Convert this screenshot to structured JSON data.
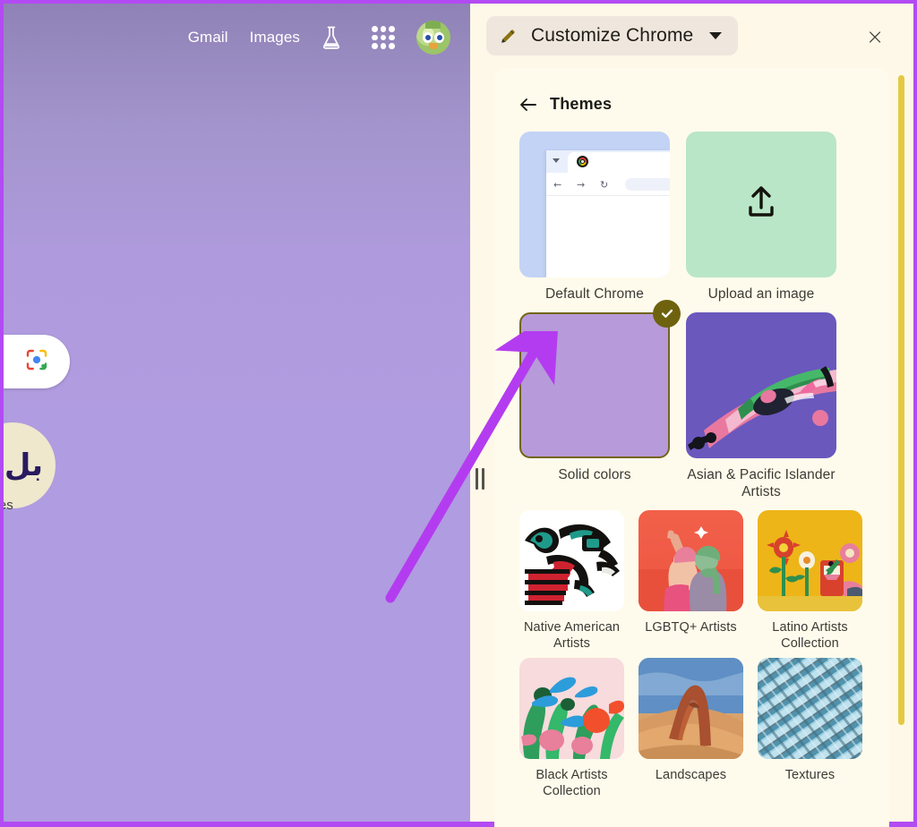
{
  "frame": {
    "border_color": "#b24bf3"
  },
  "page": {
    "background_top_color": "#8f82b6",
    "background_bottom_color": "#b09ce0",
    "topbar": {
      "links": [
        {
          "label": "Gmail",
          "name": "gmail-link"
        },
        {
          "label": "Images",
          "name": "images-link"
        }
      ],
      "labs_icon": "labs-flask-icon",
      "apps_icon": "google-apps-grid-icon",
      "avatar_icon": "account-avatar"
    },
    "lens_button": {
      "icon": "google-lens-icon"
    },
    "stories": {
      "glyph": "بل",
      "label": "ries"
    }
  },
  "panel": {
    "background_color": "#fdf8e8",
    "card_background_color": "#fffbec",
    "header": {
      "pencil_icon": "pencil-icon",
      "title": "Customize Chrome",
      "dropdown_icon": "chevron-down-icon",
      "close_label": "×"
    },
    "themes": {
      "back_icon": "back-arrow-icon",
      "title": "Themes"
    },
    "scrollbar_color": "#e3c944",
    "selection_color": "#6f620f",
    "rows": {
      "row1": [
        {
          "name": "theme-default-chrome",
          "caption": "Default Chrome",
          "selected": false
        },
        {
          "name": "theme-upload-an-image",
          "caption": "Upload an image",
          "selected": false
        }
      ],
      "row2": [
        {
          "name": "theme-solid-colors",
          "caption": "Solid colors",
          "selected": true
        },
        {
          "name": "theme-asian-pacific-islander-artists",
          "caption": "Asian & Pacific Islander Artists",
          "selected": false
        }
      ],
      "row3": [
        {
          "name": "theme-native-american-artists",
          "caption": "Native American Artists",
          "selected": false
        },
        {
          "name": "theme-lgbtq-artists",
          "caption": "LGBTQ+ Artists",
          "selected": false
        },
        {
          "name": "theme-latino-artists-collection",
          "caption": "Latino Artists Collection",
          "selected": false
        }
      ],
      "row4": [
        {
          "name": "theme-black-artists-collection",
          "caption": "Black Artists Collection",
          "selected": false
        },
        {
          "name": "theme-landscapes",
          "caption": "Landscapes",
          "selected": false
        },
        {
          "name": "theme-textures",
          "caption": "Textures",
          "selected": false
        }
      ]
    }
  },
  "drag_handle": {
    "name": "panel-resize-handle"
  },
  "annotation": {
    "arrow_color": "#b43cf0",
    "points_to": "theme-solid-colors"
  }
}
